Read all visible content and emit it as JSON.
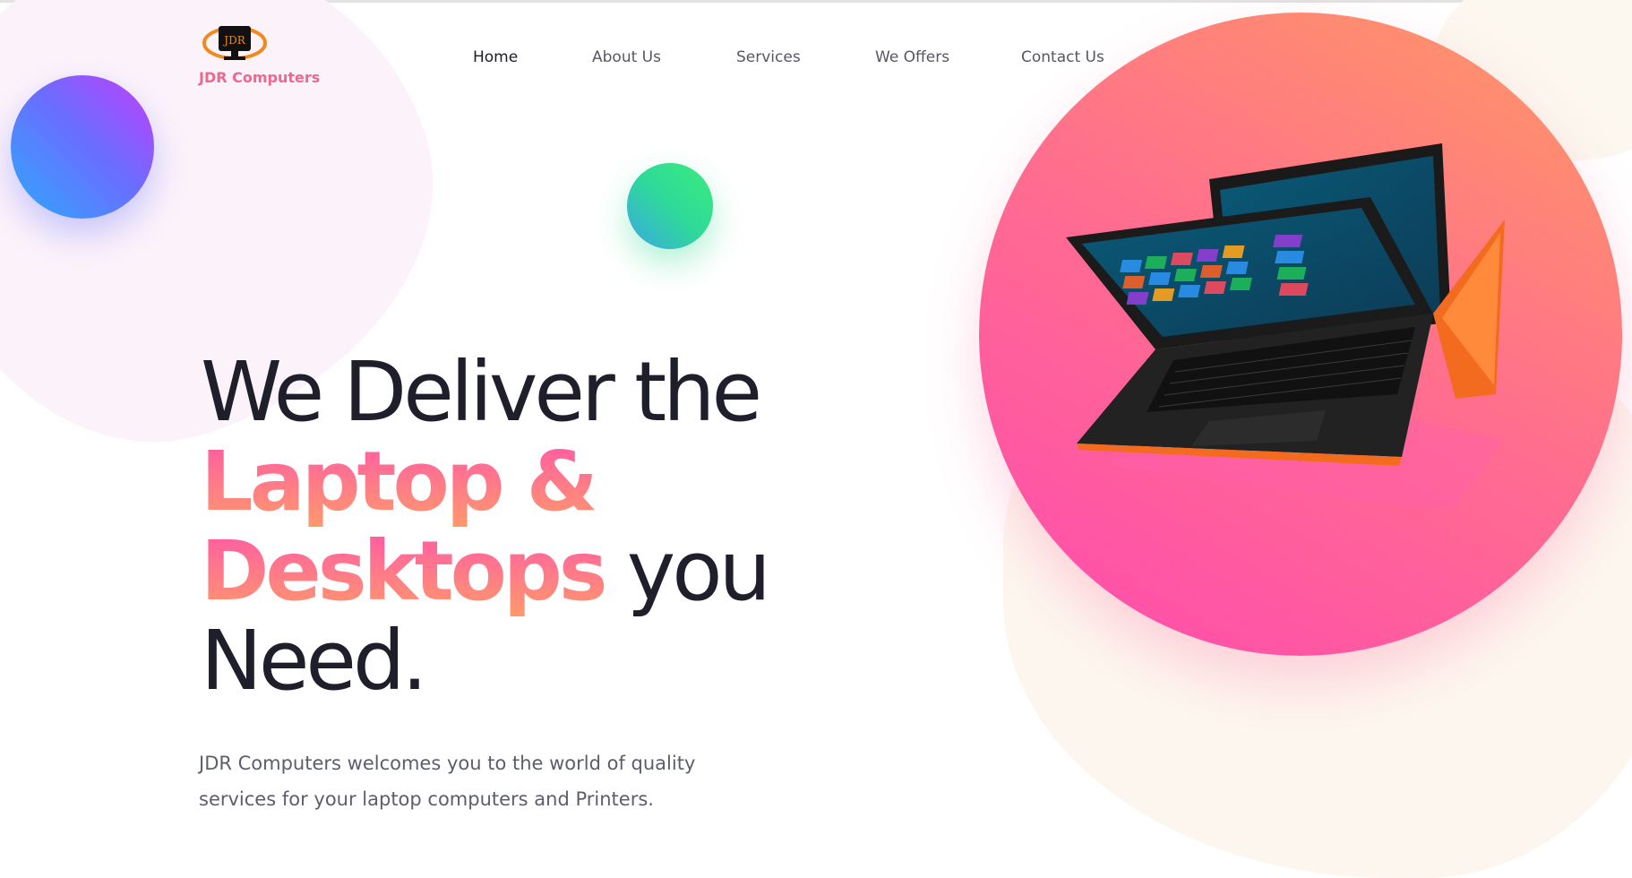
{
  "brand": {
    "name": "JDR Computers",
    "logo_badge": "JDR"
  },
  "nav": {
    "items": [
      {
        "label": "Home",
        "active": true
      },
      {
        "label": "About Us",
        "active": false
      },
      {
        "label": "Services",
        "active": false
      },
      {
        "label": "We Offers",
        "active": false
      },
      {
        "label": "Contact Us",
        "active": false
      }
    ]
  },
  "hero": {
    "line1": "We Deliver the",
    "highlight_line1": "Laptop &",
    "highlight_line2": "Desktops",
    "line3_rest": " you",
    "line4": "Need.",
    "description": "JDR Computers welcomes you to the world of quality services for your laptop computers and Printers."
  },
  "colors": {
    "accent_pink": "#ff4ab0",
    "accent_orange": "#ff9a62",
    "logo_text": "#f0678d",
    "text_dark": "#1e1f2b"
  },
  "icons": {
    "logo": "monitor-logo-icon",
    "hero_image": "convertible-laptop-illustration"
  }
}
